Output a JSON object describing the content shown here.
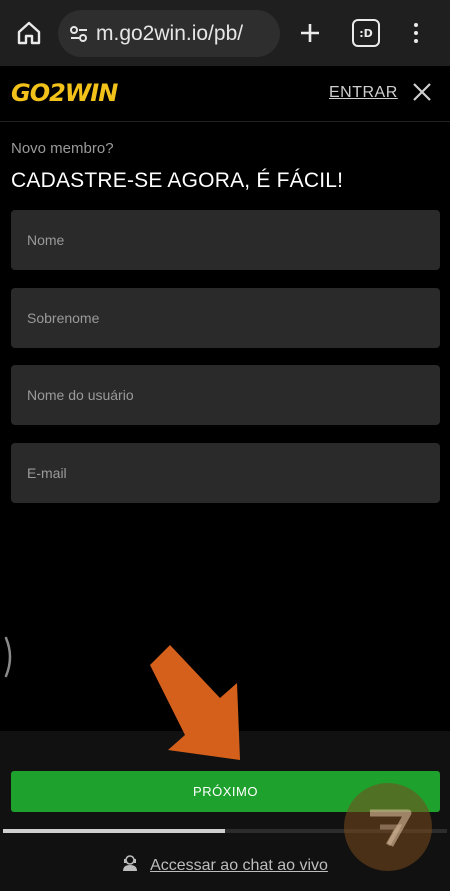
{
  "browser": {
    "url": "m.go2win.io/pb/",
    "tabs_count": ":D",
    "icons": [
      "home-icon",
      "site-settings-icon",
      "plus-icon",
      "tabs-icon",
      "more-vert-icon"
    ]
  },
  "header": {
    "logo": "GO2WIN",
    "login_label": "ENTRAR",
    "close_icon": "close-icon"
  },
  "form": {
    "subtitle": "Novo membro?",
    "heading": "CADASTRE-SE AGORA, É FÁCIL!",
    "fields": [
      {
        "placeholder": "Nome",
        "value": ""
      },
      {
        "placeholder": "Sobrenome",
        "value": ""
      },
      {
        "placeholder": "Nome do usuário",
        "value": ""
      },
      {
        "placeholder": "E-mail",
        "value": ""
      }
    ]
  },
  "footer": {
    "next_label": "PRÓXIMO",
    "progress_fraction": 0.5,
    "chat_label": "Accessar ao chat ao vivo",
    "chat_icon": "support-agent-icon"
  },
  "colors": {
    "logo": "#f2c21a",
    "button": "#1fa12d",
    "arrow": "#d4601c",
    "background": "#000000",
    "field": "#2a2a2a"
  }
}
